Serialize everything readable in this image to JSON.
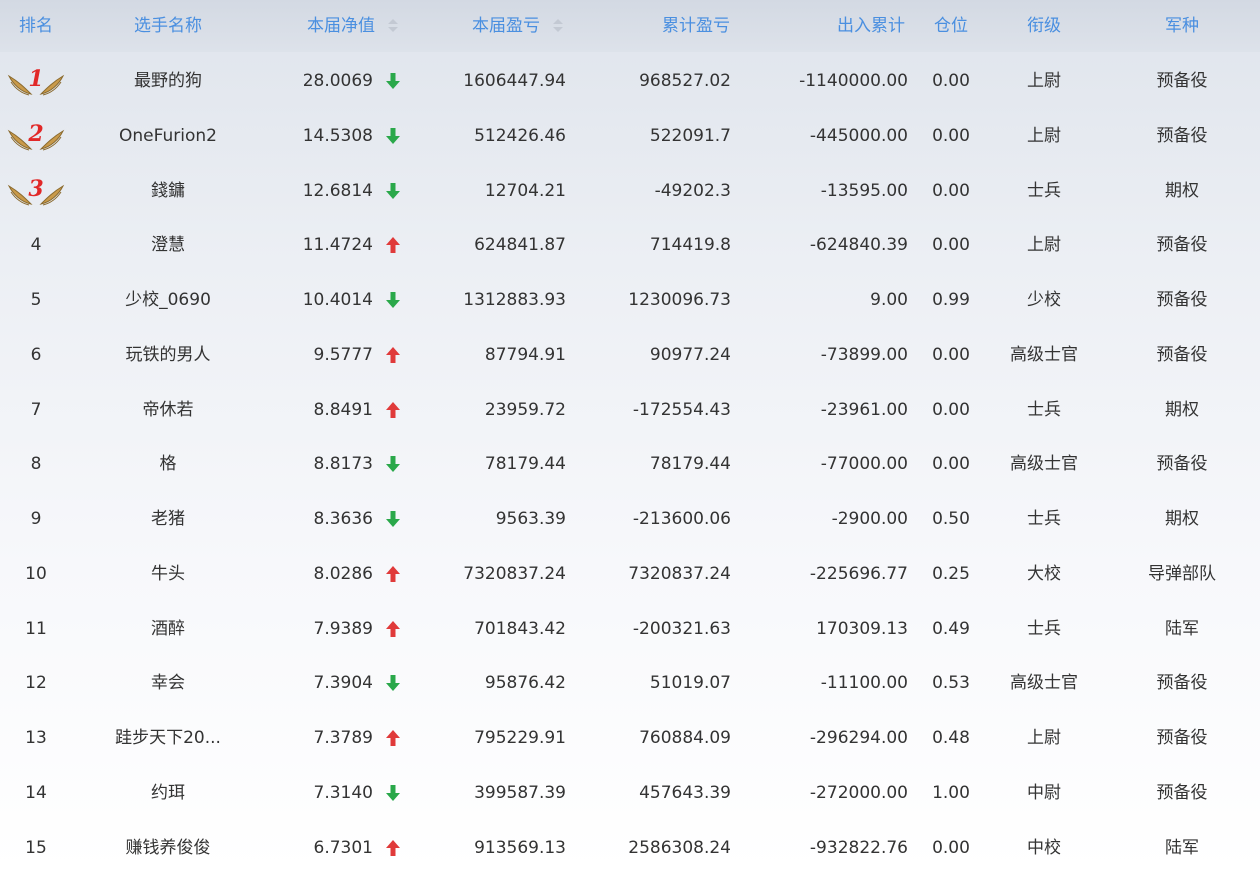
{
  "headers": {
    "rank": "排名",
    "name": "选手名称",
    "nav": "本届净值",
    "pnl": "本届盈亏",
    "cum_pnl": "累计盈亏",
    "flow": "出入累计",
    "position": "仓位",
    "grade": "衔级",
    "branch": "军种"
  },
  "colors": {
    "header_text": "#4a8fe0",
    "arrow_up": "#e03a3a",
    "arrow_down": "#2aa84a",
    "medal_number": "#e12828"
  },
  "rows": [
    {
      "rank": "1",
      "medal": true,
      "name": "最野的狗",
      "nav": "28.0069",
      "trend": "down",
      "pnl": "1606447.94",
      "cum_pnl": "968527.02",
      "flow": "-1140000.00",
      "position": "0.00",
      "grade": "上尉",
      "branch": "预备役"
    },
    {
      "rank": "2",
      "medal": true,
      "name": "OneFurion2",
      "nav": "14.5308",
      "trend": "down",
      "pnl": "512426.46",
      "cum_pnl": "522091.7",
      "flow": "-445000.00",
      "position": "0.00",
      "grade": "上尉",
      "branch": "预备役"
    },
    {
      "rank": "3",
      "medal": true,
      "name": "錢鏞",
      "nav": "12.6814",
      "trend": "down",
      "pnl": "12704.21",
      "cum_pnl": "-49202.3",
      "flow": "-13595.00",
      "position": "0.00",
      "grade": "士兵",
      "branch": "期权"
    },
    {
      "rank": "4",
      "medal": false,
      "name": "澄慧",
      "nav": "11.4724",
      "trend": "up",
      "pnl": "624841.87",
      "cum_pnl": "714419.8",
      "flow": "-624840.39",
      "position": "0.00",
      "grade": "上尉",
      "branch": "预备役"
    },
    {
      "rank": "5",
      "medal": false,
      "name": "少校_0690",
      "nav": "10.4014",
      "trend": "down",
      "pnl": "1312883.93",
      "cum_pnl": "1230096.73",
      "flow": "9.00",
      "position": "0.99",
      "grade": "少校",
      "branch": "预备役"
    },
    {
      "rank": "6",
      "medal": false,
      "name": "玩铁的男人",
      "nav": "9.5777",
      "trend": "up",
      "pnl": "87794.91",
      "cum_pnl": "90977.24",
      "flow": "-73899.00",
      "position": "0.00",
      "grade": "高级士官",
      "branch": "预备役"
    },
    {
      "rank": "7",
      "medal": false,
      "name": "帝休若",
      "nav": "8.8491",
      "trend": "up",
      "pnl": "23959.72",
      "cum_pnl": "-172554.43",
      "flow": "-23961.00",
      "position": "0.00",
      "grade": "士兵",
      "branch": "期权"
    },
    {
      "rank": "8",
      "medal": false,
      "name": "格",
      "nav": "8.8173",
      "trend": "down",
      "pnl": "78179.44",
      "cum_pnl": "78179.44",
      "flow": "-77000.00",
      "position": "0.00",
      "grade": "高级士官",
      "branch": "预备役"
    },
    {
      "rank": "9",
      "medal": false,
      "name": "老猪",
      "nav": "8.3636",
      "trend": "down",
      "pnl": "9563.39",
      "cum_pnl": "-213600.06",
      "flow": "-2900.00",
      "position": "0.50",
      "grade": "士兵",
      "branch": "期权"
    },
    {
      "rank": "10",
      "medal": false,
      "name": "牛头",
      "nav": "8.0286",
      "trend": "up",
      "pnl": "7320837.24",
      "cum_pnl": "7320837.24",
      "flow": "-225696.77",
      "position": "0.25",
      "grade": "大校",
      "branch": "导弹部队"
    },
    {
      "rank": "11",
      "medal": false,
      "name": "酒醉",
      "nav": "7.9389",
      "trend": "up",
      "pnl": "701843.42",
      "cum_pnl": "-200321.63",
      "flow": "170309.13",
      "position": "0.49",
      "grade": "士兵",
      "branch": "陆军"
    },
    {
      "rank": "12",
      "medal": false,
      "name": "幸会",
      "nav": "7.3904",
      "trend": "down",
      "pnl": "95876.42",
      "cum_pnl": "51019.07",
      "flow": "-11100.00",
      "position": "0.53",
      "grade": "高级士官",
      "branch": "预备役"
    },
    {
      "rank": "13",
      "medal": false,
      "name": "跬步天下20...",
      "nav": "7.3789",
      "trend": "up",
      "pnl": "795229.91",
      "cum_pnl": "760884.09",
      "flow": "-296294.00",
      "position": "0.48",
      "grade": "上尉",
      "branch": "预备役"
    },
    {
      "rank": "14",
      "medal": false,
      "name": "约珥",
      "nav": "7.3140",
      "trend": "down",
      "pnl": "399587.39",
      "cum_pnl": "457643.39",
      "flow": "-272000.00",
      "position": "1.00",
      "grade": "中尉",
      "branch": "预备役"
    },
    {
      "rank": "15",
      "medal": false,
      "name": "赚钱养俊俊",
      "nav": "6.7301",
      "trend": "up",
      "pnl": "913569.13",
      "cum_pnl": "2586308.24",
      "flow": "-932822.76",
      "position": "0.00",
      "grade": "中校",
      "branch": "陆军"
    }
  ]
}
